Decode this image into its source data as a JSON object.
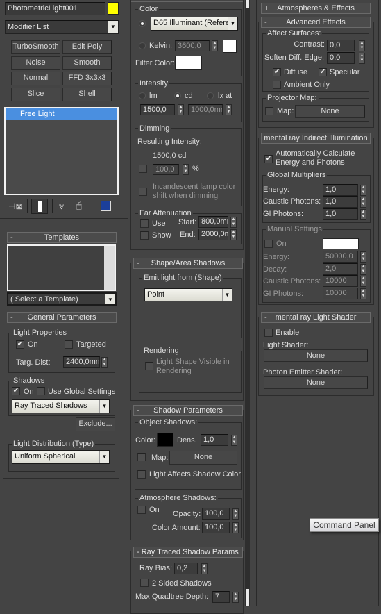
{
  "col1": {
    "object_name": "PhotometricLight001",
    "object_color": "#FFFF00",
    "modifier_list": "Modifier List",
    "modifier_buttons": [
      "TurboSmooth",
      "Edit Poly",
      "Noise",
      "Smooth",
      "Normal",
      "FFD 3x3x3",
      "Slice",
      "Shell"
    ],
    "stack_items": [
      "Free Light"
    ],
    "stack_icons": [
      "pin-stack-icon",
      "show-end-result-icon",
      "make-unique-icon",
      "remove-modifier-icon",
      "configure-modifier-sets-icon"
    ],
    "templates": {
      "header": "Templates",
      "toggle": "-",
      "select": "( Select a Template)"
    },
    "general": {
      "header": "General Parameters",
      "toggle": "-",
      "light_properties": "Light Properties",
      "on": "On",
      "on_checked": true,
      "targeted": "Targeted",
      "targeted_checked": false,
      "targ_dist_label": "Targ. Dist:",
      "targ_dist": "2400,0mm",
      "shadows": "Shadows",
      "shadows_on": "On",
      "shadows_on_checked": true,
      "use_global": "Use Global Settings",
      "use_global_checked": false,
      "shadow_type": "Ray Traced Shadows",
      "exclude": "Exclude...",
      "light_distribution": "Light Distribution (Type)",
      "distribution_type": "Uniform Spherical"
    }
  },
  "col2": {
    "color": {
      "group": "Color",
      "preset": "D65 Illuminant (Refere",
      "kelvin_label": "Kelvin:",
      "kelvin": "3600,0",
      "filter_color_label": "Filter Color:",
      "kelvin_swatch": "#FFFFFF",
      "filter_swatch": "#FFFFFF"
    },
    "intensity": {
      "group": "Intensity",
      "lm": "lm",
      "cd": "cd",
      "lx": "lx at",
      "selected": "cd",
      "value": "1500,0",
      "distance": "1000,0mm"
    },
    "dimming": {
      "group": "Dimming",
      "resulting_label": "Resulting Intensity:",
      "resulting": "1500,0 cd",
      "percent": "100,0",
      "percent_unit": "%",
      "incandescent": "Incandescent lamp color",
      "incandescent2": "shift when dimming"
    },
    "far": {
      "group": "Far Attenuation",
      "use": "Use",
      "show": "Show",
      "start_label": "Start:",
      "start": "800,0mm",
      "end_label": "End:",
      "end": "2000,0mm"
    },
    "shape": {
      "header": "Shape/Area Shadows",
      "toggle": "-",
      "emit_group": "Emit light from (Shape)",
      "emit": "Point",
      "rendering_group": "Rendering",
      "visible": "Light Shape Visible in",
      "visible2": "Rendering"
    },
    "shadow": {
      "header": "Shadow Parameters",
      "toggle": "-",
      "object_group": "Object Shadows:",
      "color_label": "Color:",
      "color": "#000000",
      "dens_label": "Dens.",
      "dens": "1,0",
      "map_label": "Map:",
      "map": "None",
      "affects": "Light Affects Shadow Color",
      "atmo_group": "Atmosphere Shadows:",
      "atmo_on": "On",
      "opacity_label": "Opacity:",
      "opacity": "100,0",
      "amount_label": "Color Amount:",
      "amount": "100,0"
    },
    "raytrace": {
      "header": "Ray Traced Shadow Params",
      "toggle": "-",
      "bias_label": "Ray Bias:",
      "bias": "0,2",
      "two_sided": "2 Sided Shadows",
      "depth_label": "Max Quadtree Depth:",
      "depth": "7"
    }
  },
  "col3": {
    "atmos": {
      "header": "Atmospheres & Effects",
      "toggle": "+"
    },
    "advanced": {
      "header": "Advanced Effects",
      "toggle": "-",
      "affect_group": "Affect Surfaces:",
      "contrast_label": "Contrast:",
      "contrast": "0,0",
      "soften_label": "Soften Diff. Edge:",
      "soften": "0,0",
      "diffuse": "Diffuse",
      "specular": "Specular",
      "ambient": "Ambient Only",
      "projector_group": "Projector Map:",
      "map_label": "Map:",
      "map": "None"
    },
    "indirect": {
      "header": "mental ray Indirect Illumination",
      "auto": "Automatically Calculate",
      "auto2": "Energy and Photons",
      "global_group": "Global Multipliers",
      "energy_label": "Energy:",
      "energy": "1,0",
      "caustic_label": "Caustic Photons:",
      "caustic": "1,0",
      "gi_label": "GI Photons:",
      "gi": "1,0",
      "manual_group": "Manual Settings",
      "on": "On",
      "m_energy": "50000,0",
      "decay_label": "Decay:",
      "decay": "2,0",
      "m_caustic": "10000",
      "m_gi": "10000",
      "swatch": "#FFFFFF"
    },
    "shader": {
      "header": "mental ray Light Shader",
      "toggle": "-",
      "enable": "Enable",
      "light_shader_label": "Light Shader:",
      "light_shader": "None",
      "photon_label": "Photon Emitter Shader:",
      "photon": "None"
    }
  },
  "tooltip": "Command Panel"
}
